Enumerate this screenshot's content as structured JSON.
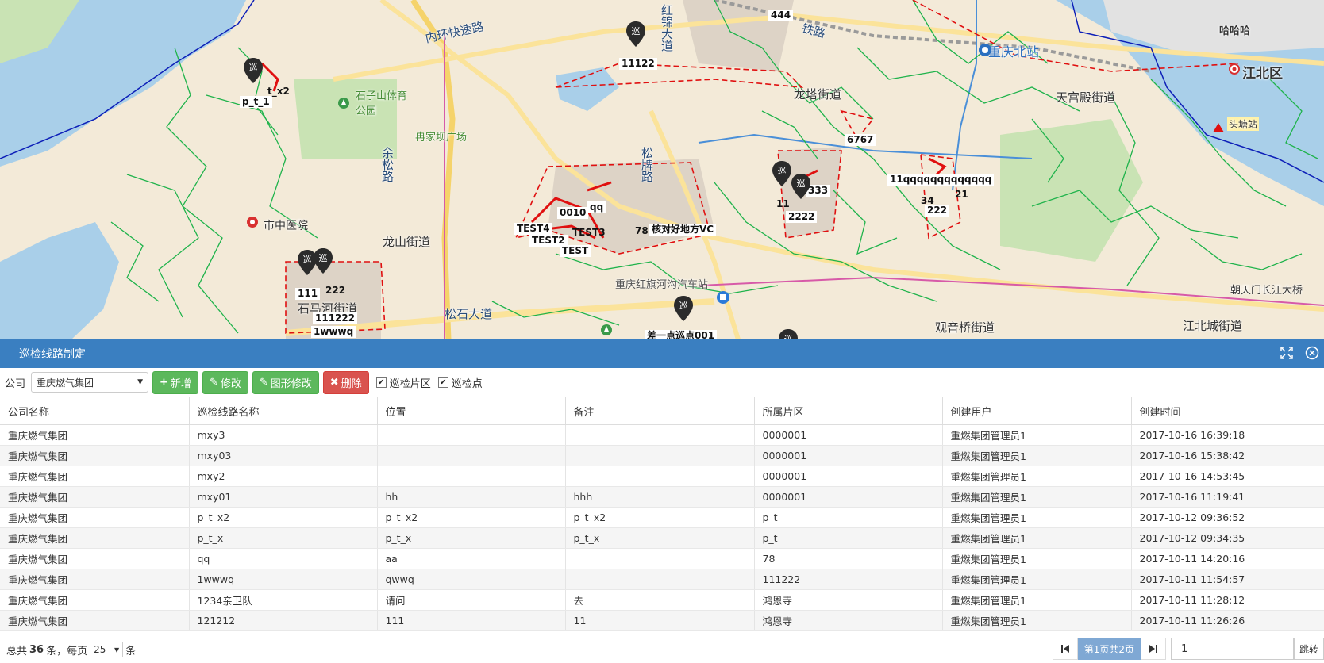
{
  "map": {
    "road_labels": [
      "内环快速路",
      "铁路",
      "松石大道",
      "余松路",
      "松牌路",
      "红锦大道"
    ],
    "place_labels": [
      "重庆北站",
      "龙塔街道",
      "天宫殿街道",
      "江北区",
      "哈哈哈",
      "头塘站",
      "石子山体育公园",
      "冉家坝广场",
      "市中医院",
      "龙山街道",
      "石马河街道",
      "观音桥街道",
      "江北城街道",
      "朝天门长江大桥",
      "重庆红旗河沟汽车站"
    ],
    "markers": [
      "p_t_1",
      "t_x2",
      "11122",
      "444",
      "6767",
      "11qqqqqqqqqqqqq",
      "34",
      "21",
      "222",
      "333",
      "11",
      "2222",
      "0010",
      "qq",
      "TEST4",
      "TEST3",
      "TEST2",
      "TEST",
      "78",
      "核对好地方VC",
      "111",
      "222",
      "111222",
      "1wwwq",
      "差一点巡点001"
    ],
    "pin_glyph": "巡",
    "station_glyph": "重庆北站"
  },
  "panel": {
    "title": "巡检线路制定",
    "icons": [
      "expand-icon",
      "close-icon"
    ]
  },
  "toolbar": {
    "company_label": "公司",
    "company_value": "重庆燃气集团",
    "add_label": "新增",
    "edit_label": "修改",
    "shape_edit_label": "图形修改",
    "delete_label": "删除",
    "chk_area_label": "巡检片区",
    "chk_point_label": "巡检点"
  },
  "table": {
    "headers": [
      "公司名称",
      "巡检线路名称",
      "位置",
      "备注",
      "所属片区",
      "创建用户",
      "创建时间"
    ],
    "rows": [
      [
        "重庆燃气集团",
        "mxy3",
        "",
        "",
        "0000001",
        "重燃集团管理员1",
        "2017-10-16 16:39:18"
      ],
      [
        "重庆燃气集团",
        "mxy03",
        "",
        "",
        "0000001",
        "重燃集团管理员1",
        "2017-10-16 15:38:42"
      ],
      [
        "重庆燃气集团",
        "mxy2",
        "",
        "",
        "0000001",
        "重燃集团管理员1",
        "2017-10-16 14:53:45"
      ],
      [
        "重庆燃气集团",
        "mxy01",
        "hh",
        "hhh",
        "0000001",
        "重燃集团管理员1",
        "2017-10-16 11:19:41"
      ],
      [
        "重庆燃气集团",
        "p_t_x2",
        "p_t_x2",
        "p_t_x2",
        "p_t",
        "重燃集团管理员1",
        "2017-10-12 09:36:52"
      ],
      [
        "重庆燃气集团",
        "p_t_x",
        "p_t_x",
        "p_t_x",
        "p_t",
        "重燃集团管理员1",
        "2017-10-12 09:34:35"
      ],
      [
        "重庆燃气集团",
        "qq",
        "aa",
        "",
        "78",
        "重燃集团管理员1",
        "2017-10-11 14:20:16"
      ],
      [
        "重庆燃气集团",
        "1wwwq",
        "qwwq",
        "",
        "111222",
        "重燃集团管理员1",
        "2017-10-11 11:54:57"
      ],
      [
        "重庆燃气集团",
        "1234亲卫队",
        "请问",
        "去",
        "鸿恩寺",
        "重燃集团管理员1",
        "2017-10-11 11:28:12"
      ],
      [
        "重庆燃气集团",
        "121212",
        "111",
        "11",
        "鸿恩寺",
        "重燃集团管理员1",
        "2017-10-11 11:26:26"
      ]
    ]
  },
  "footer": {
    "total_prefix": "总共",
    "total_count": "36",
    "total_suffix": "条，每页",
    "page_size": "25",
    "page_size_suffix": "条",
    "page_status": "第1页共2页",
    "page_input": "1",
    "go_label": "跳转"
  },
  "colors": {
    "header_bg": "#3a7fc1",
    "btn_green": "#5cb85c",
    "btn_red": "#d9534f",
    "pipe_green": "#1fb34b",
    "zone_red": "#e01010"
  }
}
